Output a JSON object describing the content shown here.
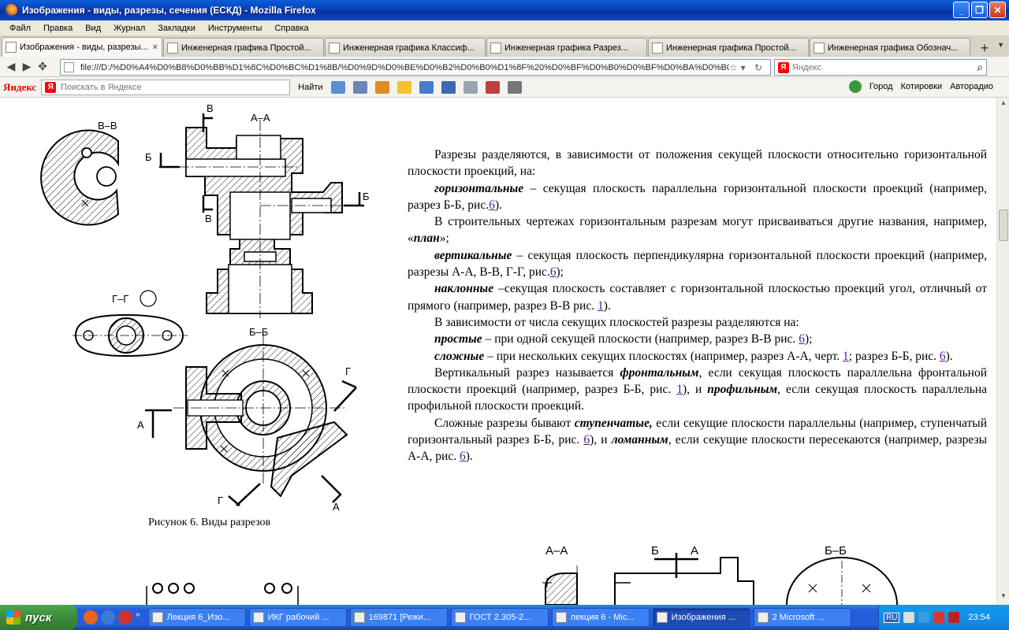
{
  "window": {
    "title": "Изображения - виды, разрезы, сечения (ЕСКД) - Mozilla Firefox",
    "buttons": {
      "minimize": "_",
      "maximize": "❐",
      "close": "✕"
    }
  },
  "menu": [
    "Файл",
    "Правка",
    "Вид",
    "Журнал",
    "Закладки",
    "Инструменты",
    "Справка"
  ],
  "tabs": [
    {
      "label": "Изображения - виды, разрезы...",
      "active": true
    },
    {
      "label": "Инженерная графика Простой...",
      "active": false
    },
    {
      "label": "Инженерная графика Классиф...",
      "active": false
    },
    {
      "label": "Инженерная графика Разрез...",
      "active": false
    },
    {
      "label": "Инженерная графика Простой...",
      "active": false
    },
    {
      "label": "Инженерная графика Обознач...",
      "active": false
    }
  ],
  "nav": {
    "url": "file:///D:/%D0%A4%D0%B8%D0%BB%D1%8C%D0%BC%D1%8B/%D0%9D%D0%BE%D0%B2%D0%B0%D1%8F%20%D0%BF%D0%B0%D0%BF%D0%BA%D0%B0.",
    "search_placeholder": "Яндекс"
  },
  "yandex_bar": {
    "brand": "Яндекс",
    "search_placeholder": "Поискать в Яндексе",
    "find_label": "Найти",
    "city": "Город",
    "quotes": "Котировки",
    "autoradio": "Авторадио"
  },
  "drawing": {
    "labels": {
      "vv": "В–В",
      "aa": "А–А",
      "gg": "Г–Г",
      "bb": "Б–Б",
      "b": "Б",
      "v": "В",
      "a": "А",
      "g": "Г"
    },
    "caption": "Рисунок 6. Виды разрезов"
  },
  "article": {
    "p1": {
      "text": "Разрезы разделяются, в зависимости от положения секущей плоскости относительно горизонтальной плоскости проекций, на:"
    },
    "p2": {
      "term": "горизонтальные",
      "text": " – секущая плоскость параллельна горизонтальной плоскости проекций (например, разрез Б-Б, рис.",
      "link": "6",
      "after": ")."
    },
    "p3": {
      "text": "В строительных чертежах горизонтальным разрезам могут присваиваться другие названия, например, «",
      "term": "план",
      "after": "»;"
    },
    "p4": {
      "term": "вертикальные",
      "text": " – секущая плоскость перпендикулярна горизонтальной плоскости проекций (например, разрезы А-А, В-В, Г-Г, рис.",
      "link": "6",
      "after": ");"
    },
    "p5": {
      "term": "наклонные",
      "text": " –секущая плоскость составляет с горизонтальной плоскостью проекций угол, отличный от прямого (например, разрез В-В рис. ",
      "link": "1",
      "after": ")."
    },
    "p6": {
      "text": "В зависимости от числа секущих плоскостей разрезы разделяются на:"
    },
    "p7": {
      "term": "простые",
      "text": " – при одной секущей плоскости (например, разрез В-В рис. ",
      "link": "6",
      "after": ");"
    },
    "p8": {
      "term": "сложные",
      "text": " – при нескольких секущих плоскостях (например, разрез А-А, черт. ",
      "link": "1",
      "mid": "; разрез Б-Б, рис. ",
      "link2": "6",
      "after": ")."
    },
    "p9": {
      "t1": "Вертикальный разрез называется ",
      "term1": "фронтальным",
      "t2": ", если секущая плоскость параллельна фронтальной плоскости проекций (например, разрез Б-Б, рис. ",
      "link": "1",
      "t3": "), и ",
      "term2": "профильным",
      "t4": ", если секущая плоскость параллельна профильной плоскости проекций."
    },
    "p10": {
      "t1": "Сложные разрезы бывают ",
      "term1": "ступенчатые,",
      "t2": " если секущие плоскости параллельны (например, ступенчатый горизонтальный разрез Б-Б, рис. ",
      "link": "6",
      "t3": "), и ",
      "term2": "ломанным",
      "t4": ", если секущие плоскости пересекаются (например, разрезы А-А, рис. ",
      "link2": "6",
      "t5": ")."
    }
  },
  "taskbar": {
    "start": "пуск",
    "tasks": [
      {
        "label": "Лекция 6_Изо...",
        "active": false
      },
      {
        "label": "ИКГ рабочий ...",
        "active": false
      },
      {
        "label": "169871 [Режи...",
        "active": false
      },
      {
        "label": "ГОСТ 2.305-2...",
        "active": false
      },
      {
        "label": "лекция 6 - Mic...",
        "active": false
      },
      {
        "label": "Изображения ...",
        "active": true
      },
      {
        "label": "2 Microsoft ...",
        "active": false
      }
    ],
    "lang": "RU",
    "clock": "23:54"
  }
}
